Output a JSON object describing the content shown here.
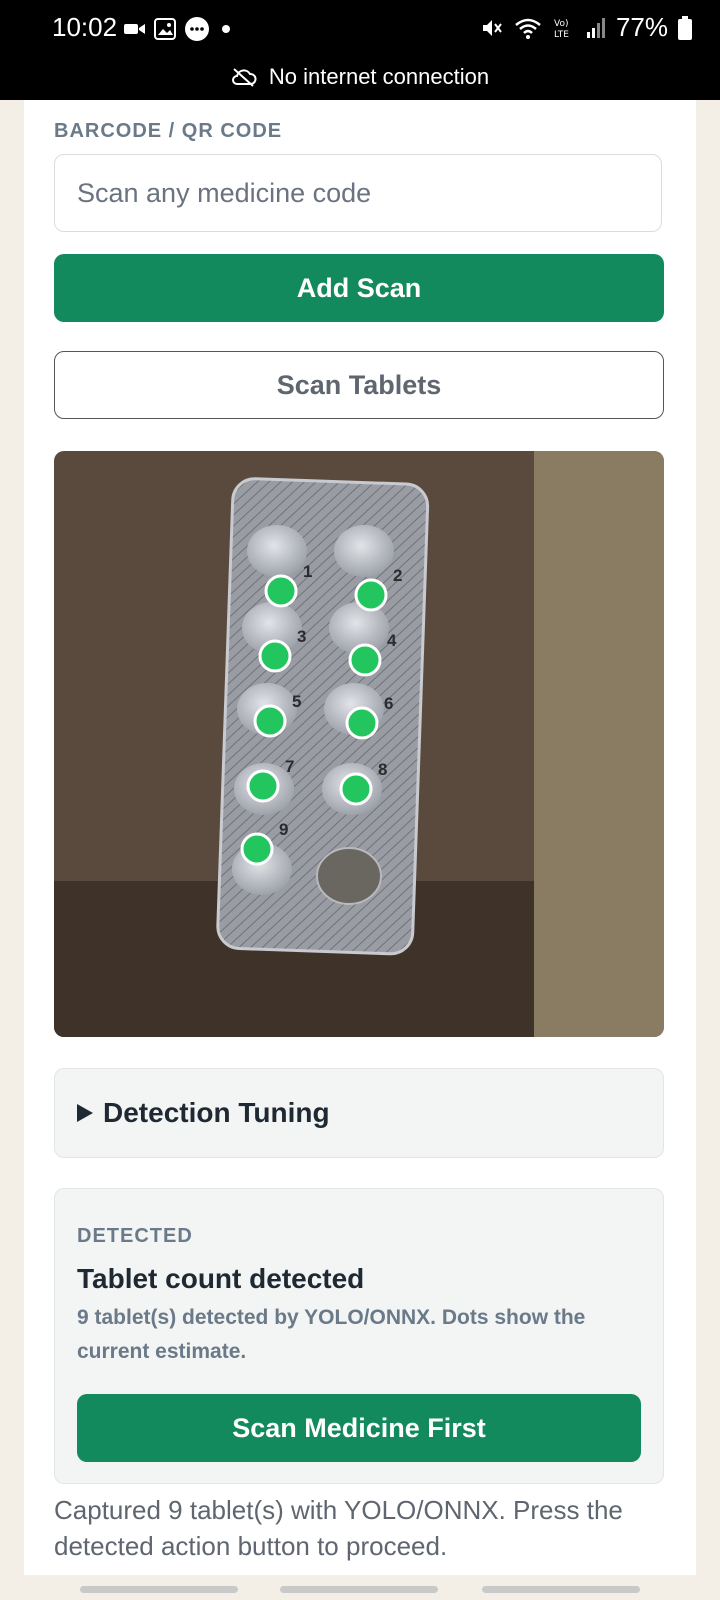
{
  "status_bar": {
    "time": "10:02",
    "battery": "77%",
    "network_message": "No internet connection",
    "icons": [
      "video-call-icon",
      "gallery-icon",
      "chat-icon",
      "dot-icon",
      "mute-icon",
      "wifi-icon",
      "volte-icon",
      "signal-icon",
      "battery-icon",
      "cloud-off-icon"
    ]
  },
  "form": {
    "label": "BARCODE / QR CODE",
    "input_placeholder": "Scan any medicine code",
    "input_value": "",
    "add_scan_label": "Add Scan",
    "scan_tablets_label": "Scan Tablets"
  },
  "detections": {
    "labels": [
      "1",
      "2",
      "3",
      "4",
      "5",
      "6",
      "7",
      "8",
      "9"
    ],
    "dot_color": "#22c55e"
  },
  "tuning": {
    "label": "Detection Tuning"
  },
  "result": {
    "label": "DETECTED",
    "title": "Tablet count detected",
    "description": "9 tablet(s) detected by YOLO/ONNX. Dots show the current estimate.",
    "button_label": "Scan Medicine First"
  },
  "footer_text": "Captured 9 tablet(s) with YOLO/ONNX. Press the detected action button to proceed.",
  "colors": {
    "primary": "#138a5e",
    "muted": "#6b7a89",
    "background": "#f3efe7"
  }
}
